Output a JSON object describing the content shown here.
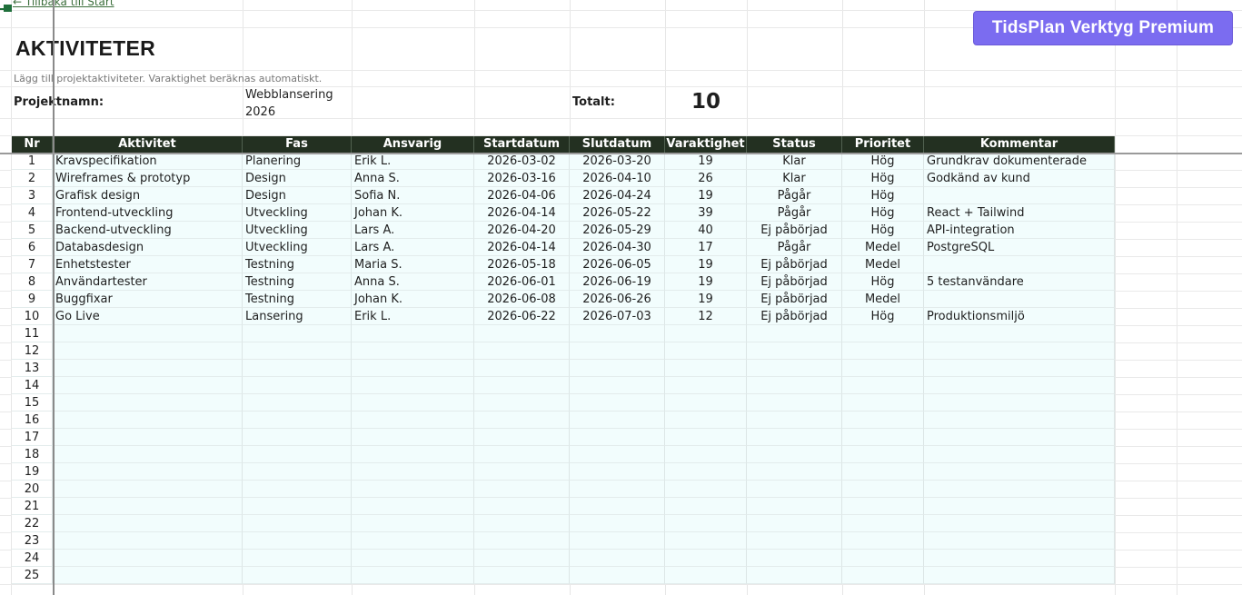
{
  "nav": {
    "back_link": "← Tillbaka till Start"
  },
  "header": {
    "title": "AKTIVITETER",
    "subtitle": "Lägg till projektaktiviteter. Varaktighet beräknas automatiskt.",
    "premium_button": "TidsPlan Verktyg Premium"
  },
  "project": {
    "label": "Projektnamn:",
    "name": "Webblansering 2026",
    "total_label": "Totalt:",
    "total_value": "10"
  },
  "colors": {
    "header_bg": "#233021",
    "premium_bg": "#7b6cf0",
    "body_bg": "#f2fdfd"
  },
  "table": {
    "columns": [
      "Nr",
      "Aktivitet",
      "Fas",
      "Ansvarig",
      "Startdatum",
      "Slutdatum",
      "Varaktighet",
      "Status",
      "Prioritet",
      "Kommentar"
    ],
    "rows": [
      {
        "nr": "1",
        "aktivitet": "Kravspecifikation",
        "fas": "Planering",
        "ansvarig": "Erik L.",
        "start": "2026-03-02",
        "slut": "2026-03-20",
        "varaktighet": "19",
        "status": "Klar",
        "prioritet": "Hög",
        "kommentar": "Grundkrav dokumenterade"
      },
      {
        "nr": "2",
        "aktivitet": "Wireframes & prototyp",
        "fas": "Design",
        "ansvarig": "Anna S.",
        "start": "2026-03-16",
        "slut": "2026-04-10",
        "varaktighet": "26",
        "status": "Klar",
        "prioritet": "Hög",
        "kommentar": "Godkänd av kund"
      },
      {
        "nr": "3",
        "aktivitet": "Grafisk design",
        "fas": "Design",
        "ansvarig": "Sofia N.",
        "start": "2026-04-06",
        "slut": "2026-04-24",
        "varaktighet": "19",
        "status": "Pågår",
        "prioritet": "Hög",
        "kommentar": ""
      },
      {
        "nr": "4",
        "aktivitet": "Frontend-utveckling",
        "fas": "Utveckling",
        "ansvarig": "Johan K.",
        "start": "2026-04-14",
        "slut": "2026-05-22",
        "varaktighet": "39",
        "status": "Pågår",
        "prioritet": "Hög",
        "kommentar": "React + Tailwind"
      },
      {
        "nr": "5",
        "aktivitet": "Backend-utveckling",
        "fas": "Utveckling",
        "ansvarig": "Lars A.",
        "start": "2026-04-20",
        "slut": "2026-05-29",
        "varaktighet": "40",
        "status": "Ej påbörjad",
        "prioritet": "Hög",
        "kommentar": "API-integration"
      },
      {
        "nr": "6",
        "aktivitet": "Databasdesign",
        "fas": "Utveckling",
        "ansvarig": "Lars A.",
        "start": "2026-04-14",
        "slut": "2026-04-30",
        "varaktighet": "17",
        "status": "Pågår",
        "prioritet": "Medel",
        "kommentar": "PostgreSQL"
      },
      {
        "nr": "7",
        "aktivitet": "Enhetstester",
        "fas": "Testning",
        "ansvarig": "Maria S.",
        "start": "2026-05-18",
        "slut": "2026-06-05",
        "varaktighet": "19",
        "status": "Ej påbörjad",
        "prioritet": "Medel",
        "kommentar": ""
      },
      {
        "nr": "8",
        "aktivitet": "Användartester",
        "fas": "Testning",
        "ansvarig": "Anna S.",
        "start": "2026-06-01",
        "slut": "2026-06-19",
        "varaktighet": "19",
        "status": "Ej påbörjad",
        "prioritet": "Hög",
        "kommentar": "5 testanvändare"
      },
      {
        "nr": "9",
        "aktivitet": "Buggfixar",
        "fas": "Testning",
        "ansvarig": "Johan K.",
        "start": "2026-06-08",
        "slut": "2026-06-26",
        "varaktighet": "19",
        "status": "Ej påbörjad",
        "prioritet": "Medel",
        "kommentar": ""
      },
      {
        "nr": "10",
        "aktivitet": "Go Live",
        "fas": "Lansering",
        "ansvarig": "Erik L.",
        "start": "2026-06-22",
        "slut": "2026-07-03",
        "varaktighet": "12",
        "status": "Ej påbörjad",
        "prioritet": "Hög",
        "kommentar": "Produktionsmiljö"
      },
      {
        "nr": "11"
      },
      {
        "nr": "12"
      },
      {
        "nr": "13"
      },
      {
        "nr": "14"
      },
      {
        "nr": "15"
      },
      {
        "nr": "16"
      },
      {
        "nr": "17"
      },
      {
        "nr": "18"
      },
      {
        "nr": "19"
      },
      {
        "nr": "20"
      },
      {
        "nr": "21"
      },
      {
        "nr": "22"
      },
      {
        "nr": "23"
      },
      {
        "nr": "24"
      },
      {
        "nr": "25"
      }
    ]
  }
}
